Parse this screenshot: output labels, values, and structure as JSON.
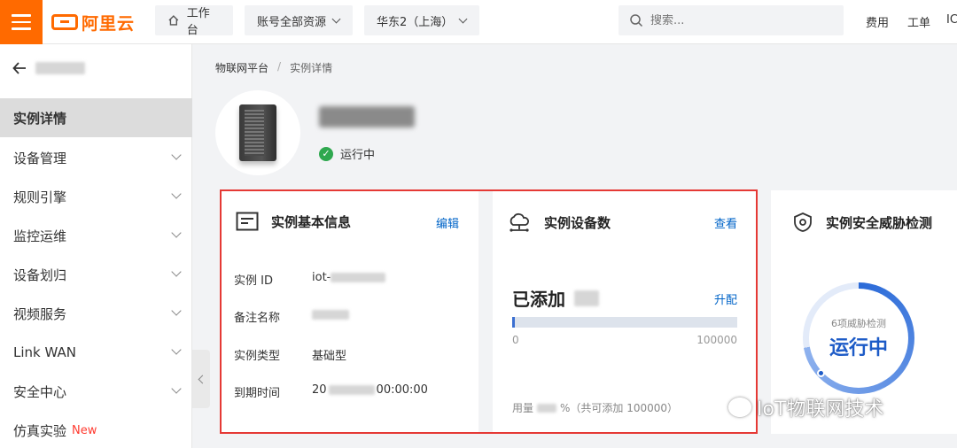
{
  "topbar": {
    "brand": "阿里云",
    "workbench": "工作台",
    "account": "账号全部资源",
    "region": "华东2（上海）",
    "search_placeholder": "搜索...",
    "fees": "费用",
    "ticket": "工单",
    "icp": "IC"
  },
  "sidebar": {
    "items": [
      {
        "label": "实例详情"
      },
      {
        "label": "设备管理"
      },
      {
        "label": "规则引擎"
      },
      {
        "label": "监控运维"
      },
      {
        "label": "设备划归"
      },
      {
        "label": "视频服务"
      },
      {
        "label": "Link WAN"
      },
      {
        "label": "安全中心"
      },
      {
        "label": "仿真实验",
        "tag": "New"
      }
    ]
  },
  "breadcrumb": {
    "root": "物联网平台",
    "sep": "/",
    "current": "实例详情"
  },
  "instance": {
    "status": "运行中"
  },
  "card_basic": {
    "title": "实例基本信息",
    "action": "编辑",
    "rows": [
      {
        "key": "实例 ID",
        "value": "iot-"
      },
      {
        "key": "备注名称",
        "value": ""
      },
      {
        "key": "实例类型",
        "value": "基础型"
      },
      {
        "key": "到期时间",
        "value_prefix": "20",
        "value_suffix": "00:00:00"
      }
    ]
  },
  "card_devices": {
    "title": "实例设备数",
    "action": "查看",
    "added_label": "已添加",
    "upgrade": "升配",
    "bar_min": "0",
    "bar_max": "100000",
    "usage_prefix": "用量",
    "usage_suffix": "%（共可添加 100000）",
    "progress_fraction": 0.004
  },
  "card_security": {
    "title": "实例安全威胁检测",
    "ring_sub": "6项威胁检测",
    "ring_main": "运行中"
  },
  "watermark": "IoT物联网技术",
  "colors": {
    "brand": "#ff6a00",
    "link": "#0064c8",
    "success": "#2fa84f",
    "highlight": "#e53935"
  }
}
